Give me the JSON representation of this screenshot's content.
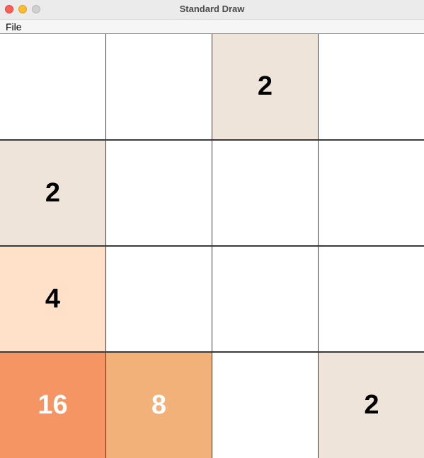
{
  "window": {
    "title": "Standard Draw"
  },
  "menu": {
    "items": [
      "File"
    ]
  },
  "board": {
    "rows": [
      [
        null,
        null,
        2,
        null
      ],
      [
        2,
        null,
        null,
        null
      ],
      [
        4,
        null,
        null,
        null
      ],
      [
        16,
        8,
        null,
        2
      ]
    ]
  },
  "tile_colors": {
    "empty": "#ffffff",
    "2": "#eee4da",
    "4": "#ffe0c8",
    "8": "#f2b179",
    "16": "#f59563",
    "border": "#3a3a3a",
    "dark_text": "#000000",
    "light_text": "#ffffff"
  }
}
